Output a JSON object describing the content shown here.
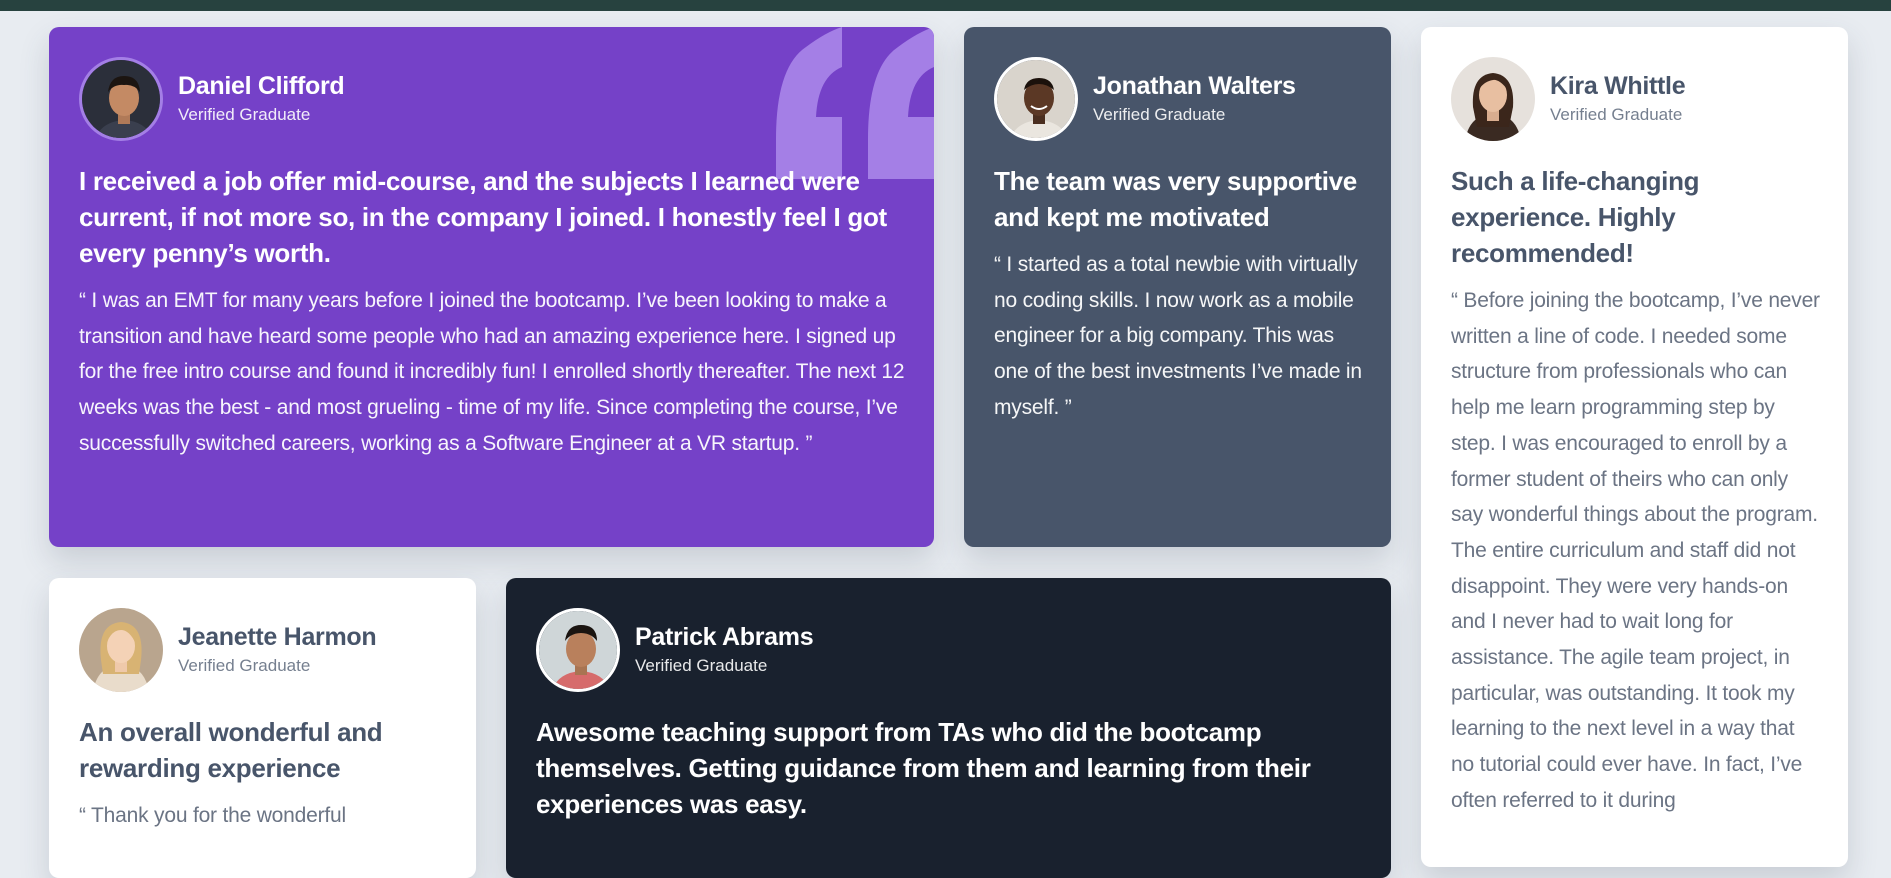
{
  "colors": {
    "top_bar": "#27423f",
    "page_background": "#e8ecf1",
    "purple_card": "#7541c8",
    "slate_card": "#48556a",
    "white_card": "#ffffff",
    "dark_card": "#19212e",
    "quote_mark": "#a47fe6"
  },
  "testimonials": [
    {
      "name": "Daniel Clifford",
      "role": "Verified Graduate",
      "avatar_icon": "man-portrait",
      "theme": "purple",
      "headline": "I received a job offer mid-course, and the subjects I learned were current, if not more so, in the company I joined. I honestly feel I got every penny’s worth.",
      "quote": "“ I was an EMT for many years before I joined the bootcamp. I’ve been looking to make a transition and have heard some people who had an amazing experience here. I signed up for the free intro course and found it incredibly fun! I enrolled shortly thereafter. The next 12 weeks was the best - and most grueling - time of my life. Since completing the course, I’ve successfully switched careers, working as a Software Engineer at a VR startup. ”"
    },
    {
      "name": "Jonathan Walters",
      "role": "Verified Graduate",
      "avatar_icon": "man-portrait",
      "theme": "slate",
      "headline": "The team was very supportive and kept me motivated",
      "quote": "“ I started as a total newbie with virtually no coding skills. I now work as a mobile engineer for a big company. This was one of the best investments I’ve made in myself. ”"
    },
    {
      "name": "Kira Whittle",
      "role": "Verified Graduate",
      "avatar_icon": "woman-portrait",
      "theme": "white",
      "headline": "Such a life-changing experience. Highly recommended!",
      "quote": "“ Before joining the bootcamp, I’ve never written a line of code. I needed some structure from professionals who can help me learn programming step by step. I was encouraged to enroll by a former student of theirs who can only say wonderful things about the program. The entire curriculum and staff did not disappoint. They were very hands-on and I never had to wait long for assistance. The agile team project, in particular, was outstanding. It took my learning to the next level in a way that no tutorial could ever have. In fact, I’ve often referred to it during"
    },
    {
      "name": "Jeanette Harmon",
      "role": "Verified Graduate",
      "avatar_icon": "woman-portrait",
      "theme": "white",
      "headline": "An overall wonderful and rewarding experience",
      "quote": "“ Thank you for the wonderful"
    },
    {
      "name": "Patrick Abrams",
      "role": "Verified Graduate",
      "avatar_icon": "man-portrait",
      "theme": "dark",
      "headline": "Awesome teaching support from TAs who did the bootcamp themselves. Getting guidance from them and learning from their experiences was easy.",
      "quote": ""
    }
  ]
}
